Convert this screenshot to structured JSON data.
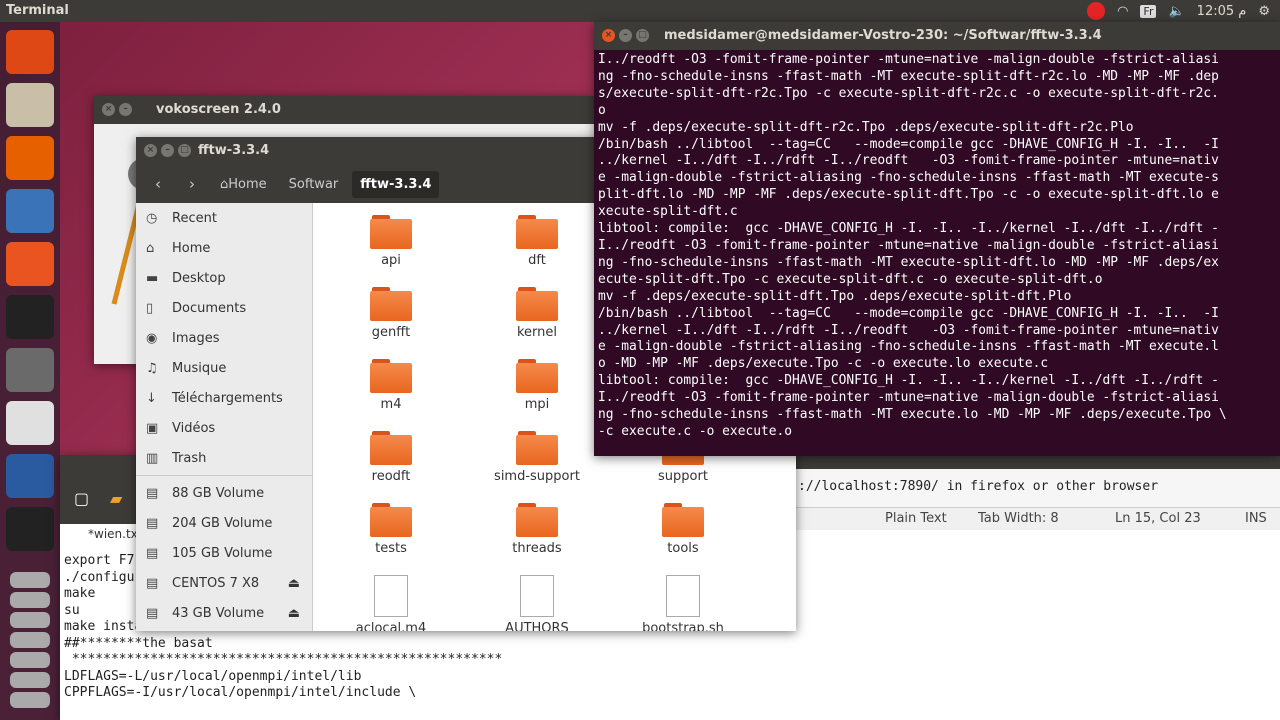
{
  "topbar": {
    "title": "Terminal",
    "kb": "Fr",
    "clock": "12:05 م"
  },
  "launcher": {
    "icons": [
      "ubuntu-icon",
      "files-icon",
      "firefox-icon",
      "writer-icon",
      "software-center-icon",
      "amazon-icon",
      "settings-icon",
      "text-editor-icon",
      "screen-recorder-icon",
      "terminal-icon",
      "workspace-icon",
      "disk-icon",
      "disk-icon",
      "disk-icon",
      "disk-icon",
      "disk-icon",
      "disk-icon"
    ]
  },
  "voko": {
    "title": "vokoscreen 2.4.0"
  },
  "term": {
    "title": "medsidamer@medsidamer-Vostro-230: ~/Softwar/fftw-3.3.4",
    "lines": [
      "I../reodft -O3 -fomit-frame-pointer -mtune=native -malign-double -fstrict-aliasi",
      "ng -fno-schedule-insns -ffast-math -MT execute-split-dft-r2c.lo -MD -MP -MF .dep",
      "s/execute-split-dft-r2c.Tpo -c execute-split-dft-r2c.c -o execute-split-dft-r2c.",
      "o",
      "mv -f .deps/execute-split-dft-r2c.Tpo .deps/execute-split-dft-r2c.Plo",
      "/bin/bash ../libtool  --tag=CC   --mode=compile gcc -DHAVE_CONFIG_H -I. -I..  -I",
      "../kernel -I../dft -I../rdft -I../reodft   -O3 -fomit-frame-pointer -mtune=nativ",
      "e -malign-double -fstrict-aliasing -fno-schedule-insns -ffast-math -MT execute-s",
      "plit-dft.lo -MD -MP -MF .deps/execute-split-dft.Tpo -c -o execute-split-dft.lo e",
      "xecute-split-dft.c",
      "libtool: compile:  gcc -DHAVE_CONFIG_H -I. -I.. -I../kernel -I../dft -I../rdft -",
      "I../reodft -O3 -fomit-frame-pointer -mtune=native -malign-double -fstrict-aliasi",
      "ng -fno-schedule-insns -ffast-math -MT execute-split-dft.lo -MD -MP -MF .deps/ex",
      "ecute-split-dft.Tpo -c execute-split-dft.c -o execute-split-dft.o",
      "mv -f .deps/execute-split-dft.Tpo .deps/execute-split-dft.Plo",
      "/bin/bash ../libtool  --tag=CC   --mode=compile gcc -DHAVE_CONFIG_H -I. -I..  -I",
      "../kernel -I../dft -I../rdft -I../reodft   -O3 -fomit-frame-pointer -mtune=nativ",
      "e -malign-double -fstrict-aliasing -fno-schedule-insns -ffast-math -MT execute.l",
      "o -MD -MP -MF .deps/execute.Tpo -c -o execute.lo execute.c",
      "libtool: compile:  gcc -DHAVE_CONFIG_H -I. -I.. -I../kernel -I../dft -I../rdft -",
      "I../reodft -O3 -fomit-frame-pointer -mtune=native -malign-double -fstrict-aliasi",
      "ng -fno-schedule-insns -ffast-math -MT execute.lo -MD -MP -MF .deps/execute.Tpo \\",
      "-c execute.c -o execute.o"
    ]
  },
  "files": {
    "title": "fftw-3.3.4",
    "crumbs": [
      "Home",
      "Softwar",
      "fftw-3.3.4"
    ],
    "sidebar": [
      {
        "icon": "clock-icon",
        "glyph": "◷",
        "label": "Recent"
      },
      {
        "icon": "home-icon",
        "glyph": "⌂",
        "label": "Home"
      },
      {
        "icon": "desktop-icon",
        "glyph": "▬",
        "label": "Desktop"
      },
      {
        "icon": "documents-icon",
        "glyph": "▯",
        "label": "Documents"
      },
      {
        "icon": "images-icon",
        "glyph": "◉",
        "label": "Images"
      },
      {
        "icon": "music-icon",
        "glyph": "♫",
        "label": "Musique"
      },
      {
        "icon": "download-icon",
        "glyph": "↓",
        "label": "Téléchargements"
      },
      {
        "icon": "videos-icon",
        "glyph": "▣",
        "label": "Vidéos"
      },
      {
        "icon": "trash-icon",
        "glyph": "▥",
        "label": "Trash"
      }
    ],
    "volumes": [
      {
        "label": "88 GB Volume",
        "eject": false
      },
      {
        "label": "204 GB Volume",
        "eject": false
      },
      {
        "label": "105 GB Volume",
        "eject": false
      },
      {
        "label": "CENTOS 7 X8",
        "eject": true
      },
      {
        "label": "43 GB Volume",
        "eject": true
      }
    ],
    "items": [
      {
        "name": "api",
        "kind": "folder"
      },
      {
        "name": "dft",
        "kind": "folder"
      },
      {
        "name": "",
        "kind": "none"
      },
      {
        "name": "genfft",
        "kind": "folder"
      },
      {
        "name": "kernel",
        "kind": "folder"
      },
      {
        "name": "",
        "kind": "none"
      },
      {
        "name": "m4",
        "kind": "folder"
      },
      {
        "name": "mpi",
        "kind": "folder"
      },
      {
        "name": "",
        "kind": "none"
      },
      {
        "name": "reodft",
        "kind": "folder"
      },
      {
        "name": "simd-support",
        "kind": "folder"
      },
      {
        "name": "support",
        "kind": "folder"
      },
      {
        "name": "tests",
        "kind": "folder"
      },
      {
        "name": "threads",
        "kind": "folder"
      },
      {
        "name": "tools",
        "kind": "folder"
      },
      {
        "name": "aclocal.m4",
        "kind": "doc"
      },
      {
        "name": "AUTHORS",
        "kind": "doc"
      },
      {
        "name": "bootstrap.sh",
        "kind": "doc"
      }
    ]
  },
  "editor": {
    "tab": "*wien.tx",
    "lines": [
      "export F7",
      "./configu",
      "make",
      "su",
      "make insta",
      "##********the basat",
      " *******************************************************",
      "LDFLAGS=-L/usr/local/openmpi/intel/lib",
      "CPPFLAGS=-I/usr/local/openmpi/intel/include \\"
    ],
    "right_line": "://localhost:7890/ in firefox or other browser",
    "status": {
      "mode": "Plain Text",
      "tab": "Tab Width: 8",
      "pos": "Ln 15, Col 23",
      "ins": "INS"
    }
  }
}
